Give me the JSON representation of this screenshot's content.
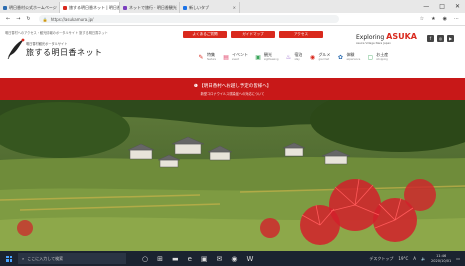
{
  "browser": {
    "tabs": [
      {
        "label": "明日香村公式ホームページ",
        "color": "#2b6cb0",
        "active": false
      },
      {
        "label": "旅する明日香ネット | 明日香村",
        "color": "#d9291d",
        "active": true
      },
      {
        "label": "ネットで旅行 · 明日香観光",
        "color": "#7b3fbf",
        "active": false
      },
      {
        "label": "新しいタブ",
        "color": "#1a73e8",
        "active": false
      }
    ],
    "url": "https://asukamura.jp/",
    "nav_glyphs": {
      "back": "←",
      "forward": "→",
      "reload": "↻"
    },
    "right_glyphs": {
      "star": "☆",
      "ext": "★",
      "profile": "◉",
      "menu": "⋯"
    },
    "window": {
      "min": "—",
      "max": "□",
      "close": "✕"
    }
  },
  "site": {
    "tagline": "明日香村へのアクセス・観光情報のポータルサイト 旅する明日香ネット",
    "logo_sub": "明日香村観光ポータルサイト",
    "logo_name": "旅する明日香ネット",
    "red_buttons": [
      {
        "label": "よくあるご質問"
      },
      {
        "label": "ガイドマップ"
      },
      {
        "label": "アクセス"
      }
    ],
    "brand_prefix": "Exploring",
    "brand_name": "ASUKA",
    "brand_sub": "Asuka Village Nara Japan",
    "sns": [
      "f",
      "◎",
      "▶"
    ],
    "nav": [
      {
        "icon": "✎",
        "label": "特集",
        "sub": "feature",
        "color": "#d9291d"
      },
      {
        "icon": "▤",
        "label": "イベント",
        "sub": "event",
        "color": "#e0446a"
      },
      {
        "icon": "▣",
        "label": "観光",
        "sub": "sightseeing",
        "color": "#3aa55a"
      },
      {
        "icon": "♨",
        "label": "宿泊",
        "sub": "stay",
        "color": "#7b3fbf"
      },
      {
        "icon": "◉",
        "label": "グルメ",
        "sub": "gourmet",
        "color": "#d9291d"
      },
      {
        "icon": "✿",
        "label": "体験",
        "sub": "experience",
        "color": "#2b6cb0"
      },
      {
        "icon": "▢",
        "label": "お土産",
        "sub": "shopping",
        "color": "#3aa55a"
      }
    ],
    "notice_title": "【明日香村へお越し予定の皆様へ】",
    "notice_sub": "新型コロナウイルス感染症への対応について"
  },
  "taskbar": {
    "search_placeholder": "ここに入力して検索",
    "icons": [
      "○",
      "⊞",
      "▬",
      "e",
      "▣",
      "✉",
      "◉",
      "W"
    ],
    "tray_text": "デスクトップ",
    "weather": "19°C",
    "ime": "A",
    "time": "11:46",
    "date": "2020/10/01"
  },
  "colors": {
    "accent": "#d9291d",
    "notice_bg": "#c81818",
    "taskbar_bg": "#1b2330"
  }
}
